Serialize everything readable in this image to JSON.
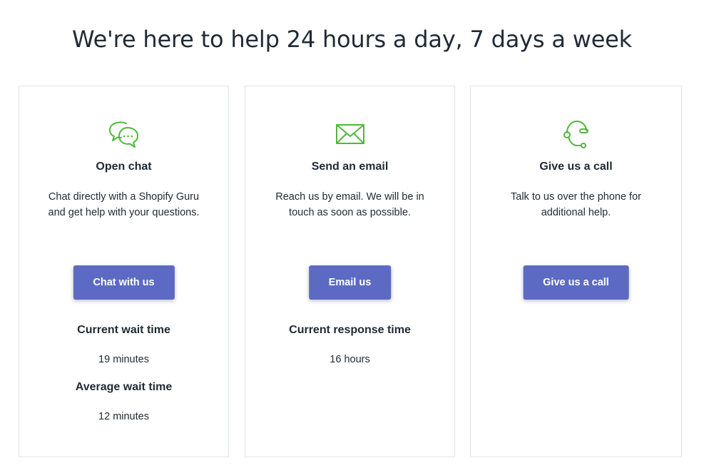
{
  "headline": "We're here to help 24 hours a day, 7 days a week",
  "colors": {
    "accent": "#5c6ac4",
    "icon_green": "#50b83c",
    "text": "#212b36",
    "border": "#dfe3e8"
  },
  "cards": [
    {
      "icon": "chat-bubbles-icon",
      "title": "Open chat",
      "description": "Chat directly with a Shopify Guru and get help with your questions.",
      "button_label": "Chat with us",
      "stats": [
        {
          "label": "Current wait time",
          "value": "19 minutes"
        },
        {
          "label": "Average wait time",
          "value": "12 minutes"
        }
      ]
    },
    {
      "icon": "envelope-icon",
      "title": "Send an email",
      "description": "Reach us by email. We will be in touch as soon as possible.",
      "button_label": "Email us",
      "stats": [
        {
          "label": "Current response time",
          "value": "16 hours"
        }
      ]
    },
    {
      "icon": "headset-icon",
      "title": "Give us a call",
      "description": "Talk to us over the phone for additional help.",
      "button_label": "Give us a call",
      "stats": []
    }
  ]
}
